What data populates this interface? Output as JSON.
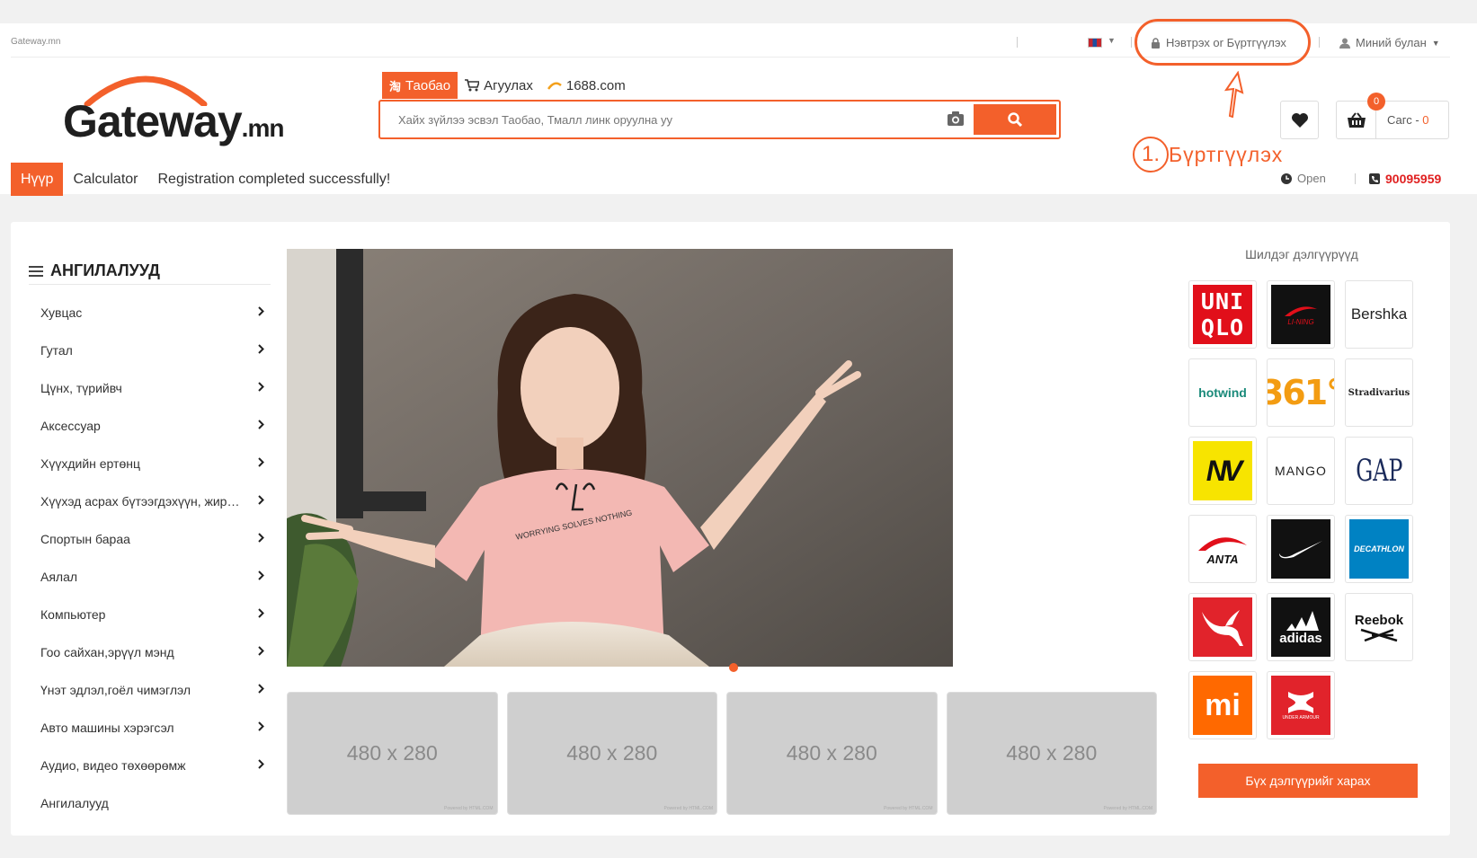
{
  "topbar": {
    "site_name": "Gateway.mn",
    "login_label": "Нэвтрэх or Бүртгүүлэх",
    "my_corner_label": "Миний булан"
  },
  "logo": {
    "main": "Gateway",
    "suffix": ".mn"
  },
  "search": {
    "tabs": [
      {
        "label": "Таобао",
        "icon": "taobao-icon"
      },
      {
        "label": "Агуулах",
        "icon": "cart-icon"
      },
      {
        "label": "1688.com",
        "icon": "1688-icon"
      }
    ],
    "placeholder": "Хайх зүйлээ эсвэл Таобао, Тмалл линк оруулна уу"
  },
  "cart": {
    "label": "Сагс - ",
    "count": "0",
    "badge": "0"
  },
  "annotation": {
    "number": "1.",
    "text": "Бүртгүүлэх"
  },
  "nav": {
    "items": [
      {
        "label": "Нүүр"
      },
      {
        "label": "Calculator"
      },
      {
        "label": "Registration completed successfully!"
      }
    ]
  },
  "status": {
    "open_label": "Open",
    "phone": "90095959"
  },
  "categories": {
    "title": "АНГИЛАЛУУД",
    "items": [
      {
        "label": "Хувцас"
      },
      {
        "label": "Гутал"
      },
      {
        "label": "Цүнх, түрийвч"
      },
      {
        "label": "Аксессуар"
      },
      {
        "label": "Хүүхдийн ертөнц"
      },
      {
        "label": "Хүүхэд асрах бүтээгдэхүүн, жирэмсэн"
      },
      {
        "label": "Спортын бараа"
      },
      {
        "label": "Аялал"
      },
      {
        "label": "Компьютер"
      },
      {
        "label": "Гоо сайхан,эрүүл мэнд"
      },
      {
        "label": "Үнэт эдлэл,гоёл чимэглэл"
      },
      {
        "label": "Авто машины хэрэгсэл"
      },
      {
        "label": "Аудио, видео төхөөрөмж"
      },
      {
        "label": "Ангилалууд"
      }
    ]
  },
  "banner": {
    "shirt_text": "WORRYING SOLVES NOTHING"
  },
  "placeholders": [
    {
      "label": "480 x 280",
      "credit": "Powered by HTML.COM"
    },
    {
      "label": "480 x 280",
      "credit": "Powered by HTML.COM"
    },
    {
      "label": "480 x 280",
      "credit": "Powered by HTML.COM"
    },
    {
      "label": "480 x 280",
      "credit": "Powered by HTML.COM"
    }
  ],
  "brands": {
    "title": "Шилдэг дэлгүүрүүд",
    "items": [
      {
        "name": "uniqlo",
        "text": "UNI QLO"
      },
      {
        "name": "li-ning",
        "text": "LI-NING"
      },
      {
        "name": "bershka",
        "text": "Bershka"
      },
      {
        "name": "hotwind",
        "text": "hotwind"
      },
      {
        "name": "361",
        "text": "361°"
      },
      {
        "name": "stradivarius",
        "text": "Stradivarius"
      },
      {
        "name": "new-balance",
        "text": "NV"
      },
      {
        "name": "mango",
        "text": "MANGO"
      },
      {
        "name": "gap",
        "text": "GAP"
      },
      {
        "name": "anta",
        "text": "ANTA"
      },
      {
        "name": "nike",
        "text": ""
      },
      {
        "name": "decathlon",
        "text": "DECATHLON"
      },
      {
        "name": "puma",
        "text": ""
      },
      {
        "name": "adidas",
        "text": "adidas"
      },
      {
        "name": "reebok",
        "text": "Reebok"
      },
      {
        "name": "xiaomi",
        "text": "mi"
      },
      {
        "name": "under-armour",
        "text": "UNDER ARMOUR"
      }
    ],
    "all_button": "Бүх дэлгүүрийг харах"
  },
  "colors": {
    "accent": "#f3602b",
    "phone": "#e02020"
  }
}
